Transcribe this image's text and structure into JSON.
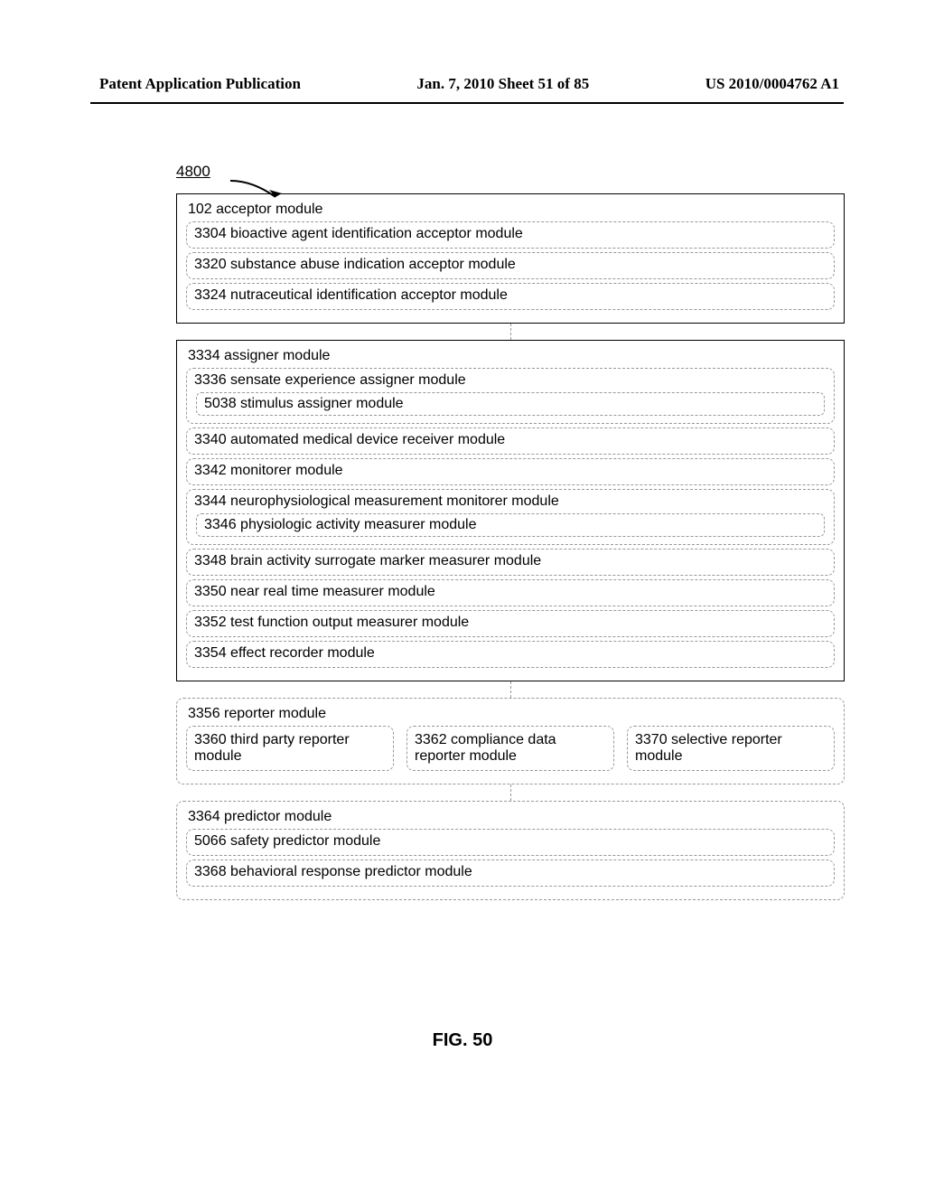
{
  "header": {
    "left": "Patent Application Publication",
    "center": "Jan. 7, 2010  Sheet 51 of 85",
    "right": "US 2010/0004762 A1"
  },
  "fig_reference": "4800",
  "acceptor": {
    "title": "102 acceptor module",
    "sub1": "3304 bioactive agent identification acceptor module",
    "sub2": "3320 substance abuse indication acceptor module",
    "sub3": "3324 nutraceutical identification acceptor module"
  },
  "assigner": {
    "title": "3334 assigner module",
    "sensate": {
      "title": "3336 sensate experience assigner module",
      "inner": "5038 stimulus assigner module"
    },
    "auto": "3340 automated medical device receiver module",
    "monitorer": "3342 monitorer module",
    "neuro": {
      "title": "3344 neurophysiological measurement monitorer module",
      "inner": "3346 physiologic activity measurer module"
    },
    "brain": "3348 brain activity surrogate marker measurer module",
    "near": "3350 near real time measurer module",
    "test": "3352 test function output measurer module",
    "effect": "3354 effect recorder module"
  },
  "reporter": {
    "title": "3356 reporter module",
    "c1": "3360 third party reporter module",
    "c2": "3362 compliance data reporter module",
    "c3": "3370 selective reporter module"
  },
  "predictor": {
    "title": "3364 predictor module",
    "safety": "5066 safety predictor module",
    "behavioral": "3368 behavioral response predictor module"
  },
  "figure_caption": "FIG. 50"
}
